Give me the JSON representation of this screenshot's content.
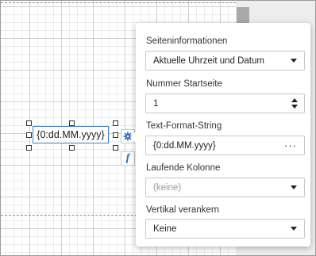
{
  "field": {
    "expression": "{0:dd.MM.yyyy}"
  },
  "side_buttons": {
    "gear_icon": "gear-icon",
    "function_icon": "function-icon",
    "function_glyph": "f"
  },
  "panel": {
    "page_info": {
      "label": "Seiteninformationen",
      "value": "Aktuelle Uhrzeit und Datum"
    },
    "start_page": {
      "label": "Nummer Startseite",
      "value": "1"
    },
    "format_string": {
      "label": "Text-Format-String",
      "value": "{0:dd.MM.yyyy}",
      "ellipsis": "···"
    },
    "running_band": {
      "label": "Laufende Kolonne",
      "placeholder": "(keine)"
    },
    "vertical_anchor": {
      "label": "Vertikal verankern",
      "value": "Keine"
    }
  },
  "colors": {
    "accent": "#2a6fb5",
    "selection_border": "#3b7dbf"
  }
}
